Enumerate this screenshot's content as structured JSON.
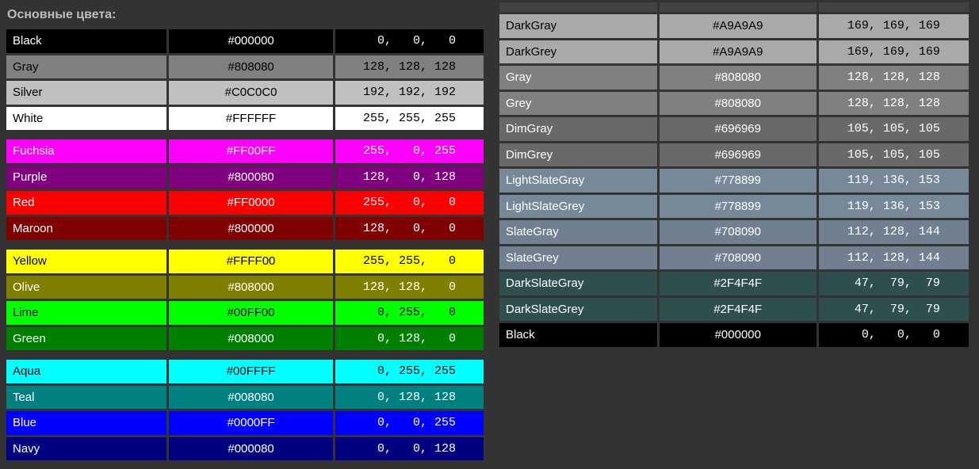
{
  "left": {
    "heading": "Основные цвета:",
    "groups": [
      [
        {
          "name": "Black",
          "hex": "#000000",
          "rgb": "  0,   0,   0",
          "bg": "#000000",
          "fg": "#ffffff"
        },
        {
          "name": "Gray",
          "hex": "#808080",
          "rgb": "128, 128, 128",
          "bg": "#808080",
          "fg": "#000000"
        },
        {
          "name": "Silver",
          "hex": "#C0C0C0",
          "rgb": "192, 192, 192",
          "bg": "#c0c0c0",
          "fg": "#000000"
        },
        {
          "name": "White",
          "hex": "#FFFFFF",
          "rgb": "255, 255, 255",
          "bg": "#ffffff",
          "fg": "#000000"
        }
      ],
      [
        {
          "name": "Fuchsia",
          "hex": "#FF00FF",
          "rgb": "255,   0, 255",
          "bg": "#ff00ff",
          "fg": "#ffffff"
        },
        {
          "name": "Purple",
          "hex": "#800080",
          "rgb": "128,   0, 128",
          "bg": "#800080",
          "fg": "#ffffff"
        },
        {
          "name": "Red",
          "hex": "#FF0000",
          "rgb": "255,   0,   0",
          "bg": "#ff0000",
          "fg": "#ffffff"
        },
        {
          "name": "Maroon",
          "hex": "#800000",
          "rgb": "128,   0,   0",
          "bg": "#800000",
          "fg": "#ffffff"
        }
      ],
      [
        {
          "name": "Yellow",
          "hex": "#FFFF00",
          "rgb": "255, 255,   0",
          "bg": "#ffff00",
          "fg": "#000000"
        },
        {
          "name": "Olive",
          "hex": "#808000",
          "rgb": "128, 128,   0",
          "bg": "#808000",
          "fg": "#ffffff"
        },
        {
          "name": "Lime",
          "hex": "#00FF00",
          "rgb": "  0, 255,   0",
          "bg": "#00ff00",
          "fg": "#000000"
        },
        {
          "name": "Green",
          "hex": "#008000",
          "rgb": "  0, 128,   0",
          "bg": "#008000",
          "fg": "#ffffff"
        }
      ],
      [
        {
          "name": "Aqua",
          "hex": "#00FFFF",
          "rgb": "  0, 255, 255",
          "bg": "#00ffff",
          "fg": "#000000"
        },
        {
          "name": "Teal",
          "hex": "#008080",
          "rgb": "  0, 128, 128",
          "bg": "#008080",
          "fg": "#ffffff"
        },
        {
          "name": "Blue",
          "hex": "#0000FF",
          "rgb": "  0,   0, 255",
          "bg": "#0000ff",
          "fg": "#ffffff"
        },
        {
          "name": "Navy",
          "hex": "#000080",
          "rgb": "  0,   0, 128",
          "bg": "#000080",
          "fg": "#ffffff"
        }
      ]
    ]
  },
  "right": {
    "rows": [
      {
        "name": "DarkGray",
        "hex": "#A9A9A9",
        "rgb": "169, 169, 169",
        "bg": "#a9a9a9",
        "fg": "#000000"
      },
      {
        "name": "DarkGrey",
        "hex": "#A9A9A9",
        "rgb": "169, 169, 169",
        "bg": "#a9a9a9",
        "fg": "#000000"
      },
      {
        "name": "Gray",
        "hex": "#808080",
        "rgb": "128, 128, 128",
        "bg": "#808080",
        "fg": "#ffffff"
      },
      {
        "name": "Grey",
        "hex": "#808080",
        "rgb": "128, 128, 128",
        "bg": "#808080",
        "fg": "#ffffff"
      },
      {
        "name": "DimGray",
        "hex": "#696969",
        "rgb": "105, 105, 105",
        "bg": "#696969",
        "fg": "#ffffff"
      },
      {
        "name": "DimGrey",
        "hex": "#696969",
        "rgb": "105, 105, 105",
        "bg": "#696969",
        "fg": "#ffffff"
      },
      {
        "name": "LightSlateGray",
        "hex": "#778899",
        "rgb": "119, 136, 153",
        "bg": "#778899",
        "fg": "#ffffff"
      },
      {
        "name": "LightSlateGrey",
        "hex": "#778899",
        "rgb": "119, 136, 153",
        "bg": "#778899",
        "fg": "#ffffff"
      },
      {
        "name": "SlateGray",
        "hex": "#708090",
        "rgb": "112, 128, 144",
        "bg": "#708090",
        "fg": "#ffffff"
      },
      {
        "name": "SlateGrey",
        "hex": "#708090",
        "rgb": "112, 128, 144",
        "bg": "#708090",
        "fg": "#ffffff"
      },
      {
        "name": "DarkSlateGray",
        "hex": "#2F4F4F",
        "rgb": " 47,  79,  79",
        "bg": "#2f4f4f",
        "fg": "#ffffff"
      },
      {
        "name": "DarkSlateGrey",
        "hex": "#2F4F4F",
        "rgb": " 47,  79,  79",
        "bg": "#2f4f4f",
        "fg": "#ffffff"
      },
      {
        "name": "Black",
        "hex": "#000000",
        "rgb": "  0,   0,   0",
        "bg": "#000000",
        "fg": "#ffffff"
      }
    ]
  }
}
